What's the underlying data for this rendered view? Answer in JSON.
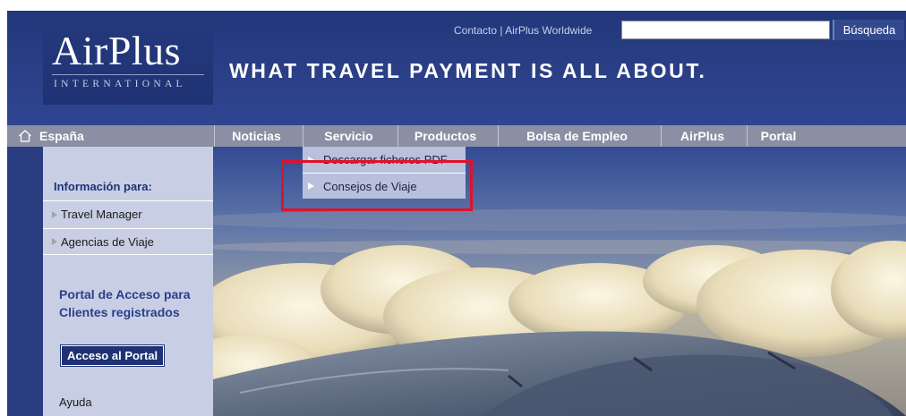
{
  "header": {
    "logo_main": "AirPlus",
    "logo_sub": "INTERNATIONAL",
    "tagline": "WHAT TRAVEL PAYMENT IS ALL ABOUT.",
    "links": {
      "contact": "Contacto",
      "separator": "|",
      "worldwide": "AirPlus Worldwide"
    },
    "search": {
      "value": "",
      "placeholder": "",
      "button_label": "Búsqueda"
    }
  },
  "nav": {
    "home_label": "España",
    "items": [
      {
        "label": "Noticias"
      },
      {
        "label": "Servicio"
      },
      {
        "label": "Productos"
      },
      {
        "label": "Bolsa de Empleo"
      },
      {
        "label": "AirPlus"
      },
      {
        "label": "Portal"
      }
    ],
    "active": "Servicio"
  },
  "dropdown": {
    "items": [
      {
        "label": "Descargar ficheros PDF"
      },
      {
        "label": "Consejos de Viaje"
      }
    ],
    "highlighted": "Consejos de Viaje"
  },
  "sidebar": {
    "title": "Información para:",
    "items": [
      {
        "label": "Travel Manager"
      },
      {
        "label": "Agencias de Viaje"
      }
    ],
    "portal_heading_line1": "Portal de Acceso para",
    "portal_heading_line2": "Clientes registrados",
    "portal_button": "Acceso al Portal",
    "help": "Ayuda"
  },
  "colors": {
    "header_bg": "#2b4088",
    "nav_bg": "#8b8fa3",
    "sidebar_bg": "#c8cfe5",
    "dropdown_bg": "#b9c0dc",
    "highlight": "#e0112b"
  },
  "icons": {
    "home": "home-icon",
    "arrow": "triangle-right-icon"
  }
}
